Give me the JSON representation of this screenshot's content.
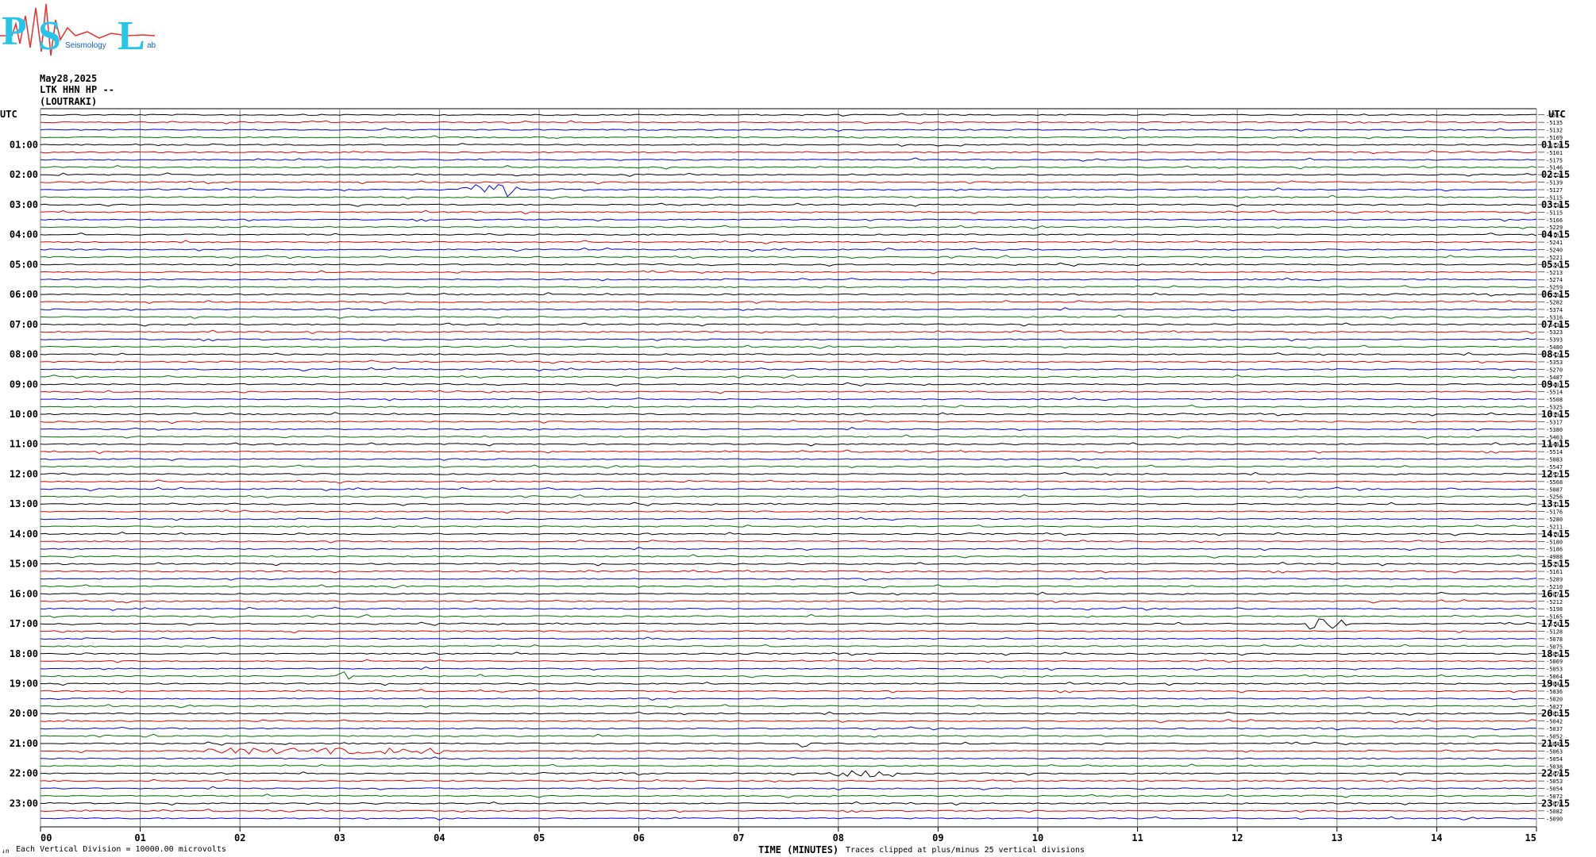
{
  "logo": {
    "big_letters": [
      "P",
      "S",
      "L"
    ],
    "small_words": [
      "Seismology",
      "ab"
    ]
  },
  "header": {
    "date": "May28,2025",
    "station": "LTK HHN HP --",
    "location": "(LOUTRAKI)",
    "utc_left": "UTC",
    "utc_right": "UTC"
  },
  "footer": {
    "left_mark": "↓n",
    "scale_note": "Each Vertical Division = 10000.00 microvolts",
    "xlabel": "TIME (MINUTES)",
    "clip_note": "Traces clipped at plus/minus 25 vertical divisions"
  },
  "colors": {
    "black": "#000000",
    "red": "#e00000",
    "blue": "#0000e0",
    "green": "#007000",
    "grid": "#808080"
  },
  "chart_data": {
    "type": "helicorder",
    "xlabel": "TIME (MINUTES)",
    "x_ticks": [
      "00",
      "01",
      "02",
      "03",
      "04",
      "05",
      "06",
      "07",
      "08",
      "09",
      "10",
      "11",
      "12",
      "13",
      "14",
      "15"
    ],
    "xlim": [
      0,
      15
    ],
    "trace_minutes": 15,
    "color_cycle": [
      "black",
      "red",
      "blue",
      "green"
    ],
    "left_hour_labels": [
      "01:00",
      "02:00",
      "03:00",
      "04:00",
      "05:00",
      "06:00",
      "07:00",
      "08:00",
      "09:00",
      "10:00",
      "11:00",
      "12:00",
      "13:00",
      "14:00",
      "15:00",
      "16:00",
      "17:00",
      "18:00",
      "19:00",
      "20:00",
      "21:00",
      "22:00",
      "23:00"
    ],
    "right_hour_labels": [
      "01:15",
      "02:15",
      "03:15",
      "04:15",
      "05:15",
      "06:15",
      "07:15",
      "08:15",
      "09:15",
      "10:15",
      "11:15",
      "12:15",
      "13:15",
      "14:15",
      "15:15",
      "16:15",
      "17:15",
      "18:15",
      "19:15",
      "20:15",
      "21:15",
      "22:15",
      "23:15"
    ],
    "right_values": [
      "-8514",
      "-5135",
      "-5132",
      "-5169",
      "-5120",
      "-5101",
      "-5175",
      "-5146",
      "-5120",
      "-5139",
      "-5127",
      "-5115",
      "-5136",
      "-5115",
      "-5166",
      "-5229",
      "-5163",
      "-5241",
      "-5240",
      "-5221",
      "-5243",
      "-5213",
      "-5274",
      "-5259",
      "-5264",
      "-5282",
      "-5374",
      "-5316",
      "-5430",
      "-5323",
      "-5393",
      "-5480",
      "-5424",
      "-5353",
      "-5270",
      "-5487",
      "-5401",
      "-5514",
      "-5508",
      "-5325",
      "-5394",
      "-5317",
      "-5380",
      "-5403",
      "-5462",
      "-5514",
      "-5083",
      "-5547",
      "-5521",
      "-5568",
      "-5087",
      "-5256",
      "-5311",
      "-5176",
      "-5280",
      "-5211",
      "-5192",
      "-5180",
      "-5186",
      "-4988",
      "-5252",
      "-5161",
      "-5289",
      "-5210",
      "-5074",
      "-5212",
      "-5198",
      "-5165",
      "-5142",
      "-5128",
      "-5078",
      "-5075",
      "-5054",
      "-5069",
      "-5053",
      "-5064",
      "-5044",
      "-5036",
      "-5020",
      "-5027",
      "-5015",
      "-5042",
      "-5037",
      "-5052",
      "-5049",
      "-5063",
      "-5054",
      "-5038",
      "-5076",
      "-5053",
      "-5054",
      "-5072",
      "-5078",
      "-5082",
      "-5090"
    ],
    "events": [
      {
        "trace": 10,
        "start_min": 4.2,
        "end_min": 4.8,
        "color": "green",
        "amplitude_div": 0.6
      },
      {
        "trace": 75,
        "start_min": 3.0,
        "end_min": 3.12,
        "color": "green",
        "amplitude_div": 0.4
      },
      {
        "trace": 68,
        "start_min": 12.7,
        "end_min": 13.1,
        "color": "red",
        "amplitude_div": 0.5
      },
      {
        "trace": 85,
        "start_min": 1.6,
        "end_min": 4.0,
        "color": "red",
        "amplitude_div": 0.25
      },
      {
        "trace": 84,
        "start_min": 7.6,
        "end_min": 7.7,
        "color": "green",
        "amplitude_div": 0.3
      },
      {
        "trace": 88,
        "start_min": 7.8,
        "end_min": 8.6,
        "color": "black",
        "amplitude_div": 0.3
      }
    ]
  }
}
